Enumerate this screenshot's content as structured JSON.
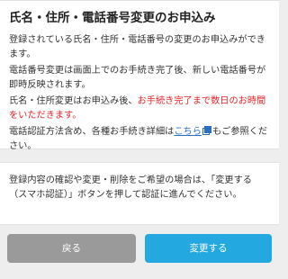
{
  "info_card": {
    "title": "氏名・住所・電話番号変更のお申込み",
    "para1": "登録されている氏名・住所・電話番号の変更のお申込みができます。",
    "para2": "電話番号変更は画面上でのお手続き完了後、新しい電話番号が即時反映されます。",
    "para3_prefix": "氏名・住所変更はお申込み後、",
    "para3_highlight": "お手続き完了まで数日のお時間をいただきます。",
    "para4_prefix": "電話認証方法含め、各種お手続き詳細は",
    "para4_link": "こちら",
    "para4_suffix": "もご参照ください。",
    "link_icon": "external-link-icon"
  },
  "note_card": {
    "text": "登録内容の確認や変更・削除をご希望の場合は、「変更する（スマホ認証）」ボタンを押して認証に進んでください。"
  },
  "buttons": {
    "back_label": "戻る",
    "change_label": "変更する"
  },
  "colors": {
    "accent": "#23a8e0",
    "back_button": "#9a9a9a",
    "warning_text": "#e5252a",
    "link": "#2a6fc6"
  }
}
